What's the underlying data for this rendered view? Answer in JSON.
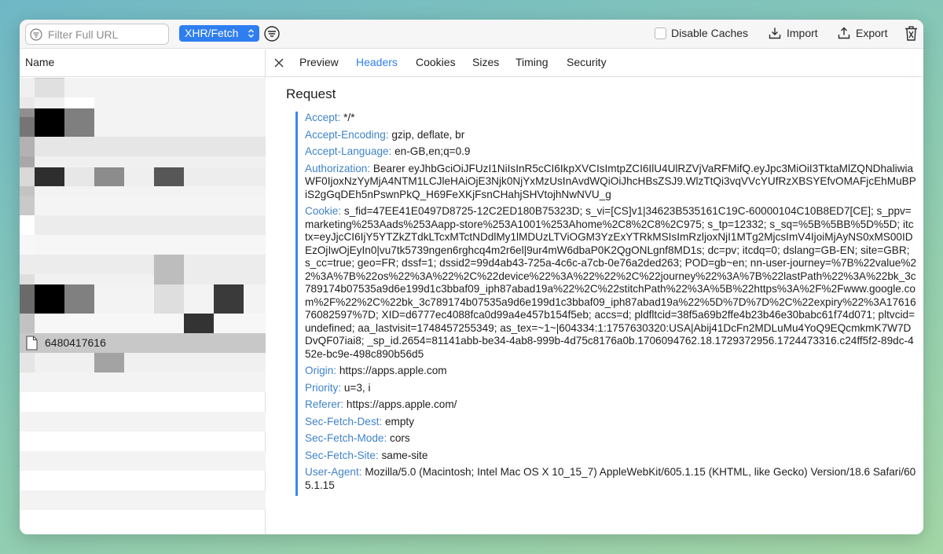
{
  "toolbar": {
    "filter_placeholder": "Filter Full URL",
    "type_filter": "XHR/Fetch",
    "disable_caches": "Disable Caches",
    "import": "Import",
    "export": "Export"
  },
  "sidebar": {
    "column_header": "Name",
    "selected_file": "6480417616"
  },
  "tabs": [
    "Preview",
    "Headers",
    "Cookies",
    "Sizes",
    "Timing",
    "Security"
  ],
  "active_tab": "Headers",
  "request": {
    "title": "Request",
    "headers": [
      {
        "key": "Accept:",
        "value": "*/*"
      },
      {
        "key": "Accept-Encoding:",
        "value": "gzip, deflate, br"
      },
      {
        "key": "Accept-Language:",
        "value": "en-GB,en;q=0.9"
      },
      {
        "key": "Authorization:",
        "value": "Bearer eyJhbGciOiJFUzI1NiIsInR5cCI6IkpXVCIsImtpZCI6IlU4UlRZVjVaRFMifQ.eyJpc3MiOiI3TktaMlZQNDhaliwiaWF0IjoxNzYyMjA4NTM1LCJleHAiOjE3Njk0NjYxMzUsInAvdWQiOiJhcHBsZSJ9.WlzTtQi3vqVVcYUfRzXBSYEfvOMAFjcEhMuBPiS2gGqDEh5nPswnPkQ_H69FeXKjFsnCHahjSHVtojhNwNVU_g"
      },
      {
        "key": "Cookie:",
        "value": "s_fid=47EE41E0497D8725-12C2ED180B75323D; s_vi=[CS]v1|34623B535161C19C-60000104C10B8ED7[CE]; s_ppv=marketing%253Aads%253Aapp-store%253A1001%253Ahome%2C8%2C8%2C975; s_tp=12332; s_sq=%5B%5BB%5D%5D; itctx=eyJjcCI6IjY5YTZkZTdkLTcxMTctNDdlMy1lMDUzLTViOGM3YzExYTRkMSIsImRzljoxNjI1MTg2MjcsImV4IjoiMjAyNS0xMS00IDEzOjIwOjEyIn0|vu7tk5739ngen6rghcq4m2r6el|9ur4mW6dbaP0K2QgONLgnf8MD1s; dc=pv; itcdq=0; dslang=GB-EN; site=GBR; s_cc=true; geo=FR; dssf=1; dssid2=99d4ab43-725a-4c6c-a7cb-0e76a2ded263; POD=gb~en; nn-user-journey=%7B%22value%22%3A%7B%22os%22%3A%22%2C%22device%22%3A%22%22%2C%22journey%22%3A%7B%22lastPath%22%3A%22bk_3c789174b07535a9d6e199d1c3bbaf09_iph87abad19a%22%2C%22stitchPath%22%3A%5B%22https%3A%2F%2Fwww.google.com%2F%22%2C%22bk_3c789174b07535a9d6e199d1c3bbaf09_iph87abad19a%22%5D%7D%7D%2C%22expiry%22%3A1761676082597%7D; XID=d6777ec4088fca0d99a4e457b154f5eb; accs=d; pldfltcid=38f5a69b2ffe4b23b46e30babc61f74d071; pltvcid=undefined; aa_lastvisit=1748457255349; as_tex=~1~|604334:1:1757630320:USA|Abij41DcFn2MDLuMu4YoQ9EQcmkmK7W7DDvQF07iai8; _sp_id.2654=81141abb-be34-4ab8-999b-4d75c8176a0b.1706094762.18.1729372956.1724473316.c24ff5f2-89dc-452e-bc9e-498c890b56d5"
      },
      {
        "key": "Origin:",
        "value": "https://apps.apple.com"
      },
      {
        "key": "Priority:",
        "value": "u=3, i"
      },
      {
        "key": "Referer:",
        "value": "https://apps.apple.com/"
      },
      {
        "key": "Sec-Fetch-Dest:",
        "value": "empty"
      },
      {
        "key": "Sec-Fetch-Mode:",
        "value": "cors"
      },
      {
        "key": "Sec-Fetch-Site:",
        "value": "same-site"
      },
      {
        "key": "User-Agent:",
        "value": "Mozilla/5.0 (Macintosh; Intel Mac OS X 10_15_7) AppleWebKit/605.1.15 (KHTML, like Gecko) Version/18.6 Safari/605.1.15"
      }
    ]
  },
  "colors": {
    "accent": "#2f7ef0",
    "header_key": "#3f83c8",
    "selected_row": "#c8c8c8"
  }
}
